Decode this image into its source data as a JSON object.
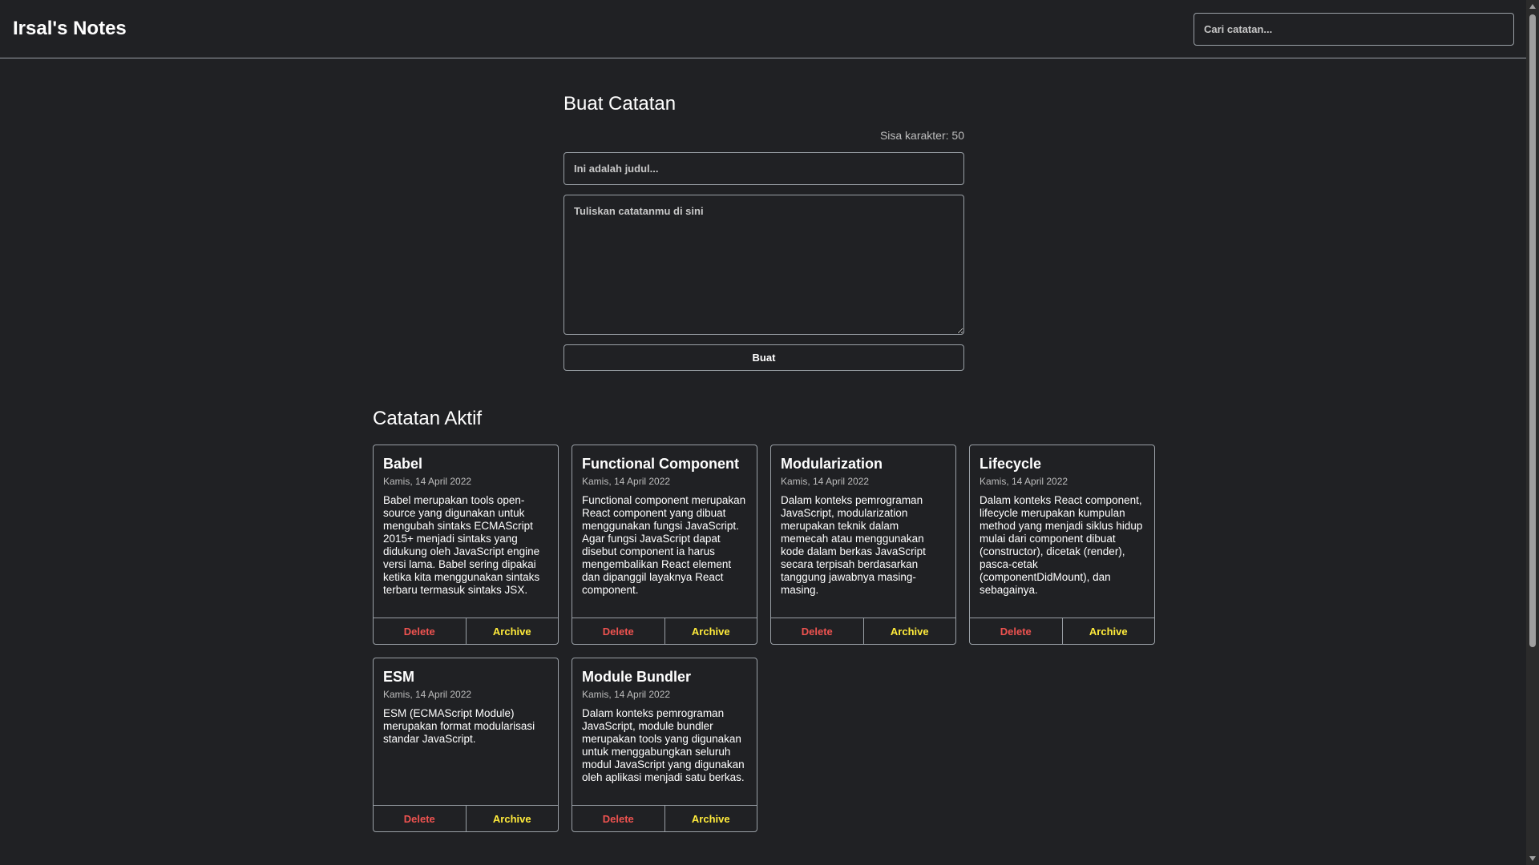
{
  "header": {
    "title": "Irsal's Notes",
    "search_placeholder": "Cari catatan..."
  },
  "form": {
    "title": "Buat Catatan",
    "char_remaining": "Sisa karakter: 50",
    "title_placeholder": "Ini adalah judul...",
    "body_placeholder": "Tuliskan catatanmu di sini",
    "create_label": "Buat"
  },
  "notes": {
    "heading": "Catatan Aktif",
    "delete_label": "Delete",
    "archive_label": "Archive",
    "items": [
      {
        "title": "Babel",
        "date": "Kamis, 14 April 2022",
        "body": "Babel merupakan tools open-source yang digunakan untuk mengubah sintaks ECMAScript 2015+ menjadi sintaks yang didukung oleh JavaScript engine versi lama. Babel sering dipakai ketika kita menggunakan sintaks terbaru termasuk sintaks JSX."
      },
      {
        "title": "Functional Component",
        "date": "Kamis, 14 April 2022",
        "body": "Functional component merupakan React component yang dibuat menggunakan fungsi JavaScript. Agar fungsi JavaScript dapat disebut component ia harus mengembalikan React element dan dipanggil layaknya React component."
      },
      {
        "title": "Modularization",
        "date": "Kamis, 14 April 2022",
        "body": "Dalam konteks pemrograman JavaScript, modularization merupakan teknik dalam memecah atau menggunakan kode dalam berkas JavaScript secara terpisah berdasarkan tanggung jawabnya masing-masing."
      },
      {
        "title": "Lifecycle",
        "date": "Kamis, 14 April 2022",
        "body": "Dalam konteks React component, lifecycle merupakan kumpulan method yang menjadi siklus hidup mulai dari component dibuat (constructor), dicetak (render), pasca-cetak (componentDidMount), dan sebagainya."
      },
      {
        "title": "ESM",
        "date": "Kamis, 14 April 2022",
        "body": "ESM (ECMAScript Module) merupakan format modularisasi standar JavaScript."
      },
      {
        "title": "Module Bundler",
        "date": "Kamis, 14 April 2022",
        "body": "Dalam konteks pemrograman JavaScript, module bundler merupakan tools yang digunakan untuk menggabungkan seluruh modul JavaScript yang digunakan oleh aplikasi menjadi satu berkas."
      }
    ]
  }
}
